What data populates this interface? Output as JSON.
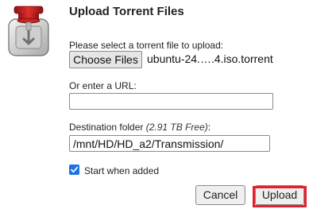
{
  "dialog": {
    "title": "Upload Torrent Files",
    "select_label": "Please select a torrent file to upload:",
    "choose_files_label": "Choose Files",
    "chosen_file": "ubuntu-24.….4.iso.torrent",
    "url_label": "Or enter a URL:",
    "url_value": "",
    "destination_label": "Destination folder",
    "free_space": "(2.91 TB Free)",
    "destination_colon": ":",
    "destination_value": "/mnt/HD/HD_a2/Transmission/",
    "start_when_added_label": "Start when added",
    "start_when_added_checked": true,
    "cancel_label": "Cancel",
    "upload_label": "Upload"
  },
  "icons": {
    "app_icon": "transmission-icon",
    "checkmark": "checkmark-icon"
  },
  "colors": {
    "accent": "#1a73e8",
    "highlight": "#e3202c"
  }
}
